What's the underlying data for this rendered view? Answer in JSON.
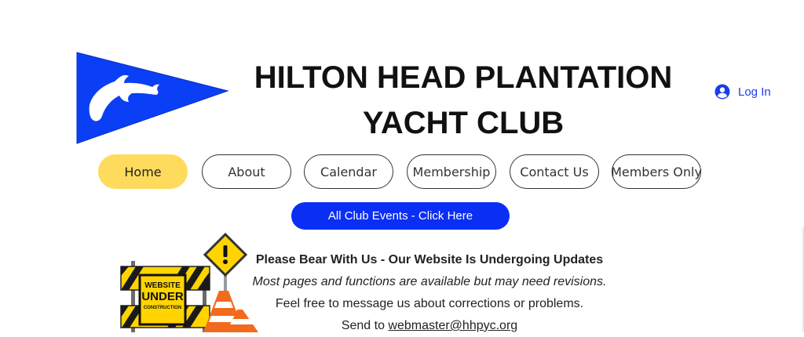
{
  "header": {
    "title_line1": "HILTON HEAD PLANTATION",
    "title_line2": "YACHT CLUB",
    "login_label": "Log In",
    "logo_icon": "dolphin-burgee-icon",
    "user_icon": "user-icon"
  },
  "nav": {
    "items": [
      {
        "label": "Home",
        "active": true
      },
      {
        "label": "About"
      },
      {
        "label": "Calendar"
      },
      {
        "label": "Membership"
      },
      {
        "label": "Contact Us"
      },
      {
        "label": "Members Only"
      }
    ]
  },
  "events_button": {
    "label": "All Club Events - Click Here"
  },
  "notice": {
    "heading": "Please Bear With Us - Our Website Is Undergoing Updates",
    "subheading": "Most pages and functions are available but may need revisions.",
    "message": "Feel free to message us about corrections or problems.",
    "send_prefix": "Send to ",
    "email": "webmaster@hhpyc.org",
    "sign_line1": "WEBSITE",
    "sign_line2": "UNDER",
    "sign_line3": "CONSTRUCTION"
  },
  "colors": {
    "flag_blue": "#0b3ff5",
    "accent_yellow": "#fedb5c",
    "button_blue": "#0b2ef5",
    "link_blue": "#1a3de8"
  }
}
